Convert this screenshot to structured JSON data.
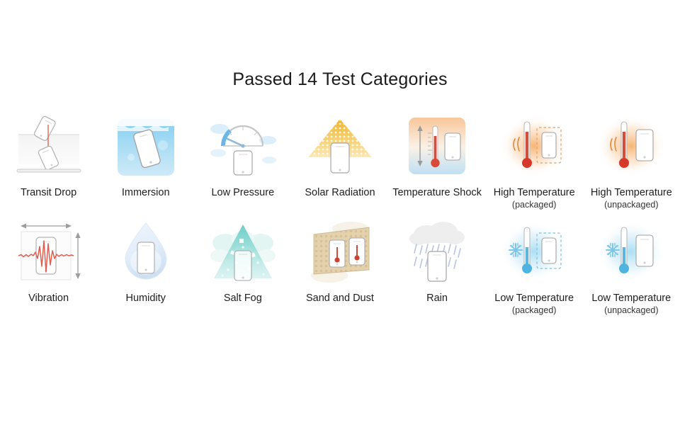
{
  "header": {
    "title": "Passed 14 Test Categories"
  },
  "colors": {
    "background": "#ffffff",
    "title_text": "#1b1b1b",
    "label_text": "#1e1e1e",
    "sublabel_text": "#333333",
    "hot_accent": "#e8452c",
    "cold_accent": "#4fb3e0",
    "water_blue": "#7ec8ec",
    "solar_yellow": "#f3c243",
    "salt_fog_teal": "#6fd0cb",
    "sand_tan": "#ddc9a3",
    "rain_blue": "#93a9d8",
    "phone_outline": "#9a9a9a"
  },
  "grid": {
    "columns": 7,
    "rows": 2,
    "total_categories": 14
  },
  "tests": [
    {
      "id": "transit-drop",
      "label": "Transit Drop",
      "sublabel": "",
      "icon": "transit-drop-icon"
    },
    {
      "id": "immersion",
      "label": "Immersion",
      "sublabel": "",
      "icon": "immersion-icon"
    },
    {
      "id": "low-pressure",
      "label": "Low Pressure",
      "sublabel": "",
      "icon": "low-pressure-icon"
    },
    {
      "id": "solar-radiation",
      "label": "Solar Radiation",
      "sublabel": "",
      "icon": "solar-radiation-icon"
    },
    {
      "id": "temperature-shock",
      "label": "Temperature Shock",
      "sublabel": "",
      "icon": "temperature-shock-icon"
    },
    {
      "id": "high-temperature-packaged",
      "label": "High Temperature",
      "sublabel": "(packaged)",
      "icon": "high-temperature-packaged-icon"
    },
    {
      "id": "high-temperature-unpackaged",
      "label": "High Temperature",
      "sublabel": "(unpackaged)",
      "icon": "high-temperature-unpackaged-icon"
    },
    {
      "id": "vibration",
      "label": "Vibration",
      "sublabel": "",
      "icon": "vibration-icon"
    },
    {
      "id": "humidity",
      "label": "Humidity",
      "sublabel": "",
      "icon": "humidity-icon"
    },
    {
      "id": "salt-fog",
      "label": "Salt Fog",
      "sublabel": "",
      "icon": "salt-fog-icon"
    },
    {
      "id": "sand-and-dust",
      "label": "Sand and Dust",
      "sublabel": "",
      "icon": "sand-and-dust-icon"
    },
    {
      "id": "rain",
      "label": "Rain",
      "sublabel": "",
      "icon": "rain-icon"
    },
    {
      "id": "low-temperature-packaged",
      "label": "Low Temperature",
      "sublabel": "(packaged)",
      "icon": "low-temperature-packaged-icon"
    },
    {
      "id": "low-temperature-unpackaged",
      "label": "Low Temperature",
      "sublabel": "(unpackaged)",
      "icon": "low-temperature-unpackaged-icon"
    }
  ]
}
